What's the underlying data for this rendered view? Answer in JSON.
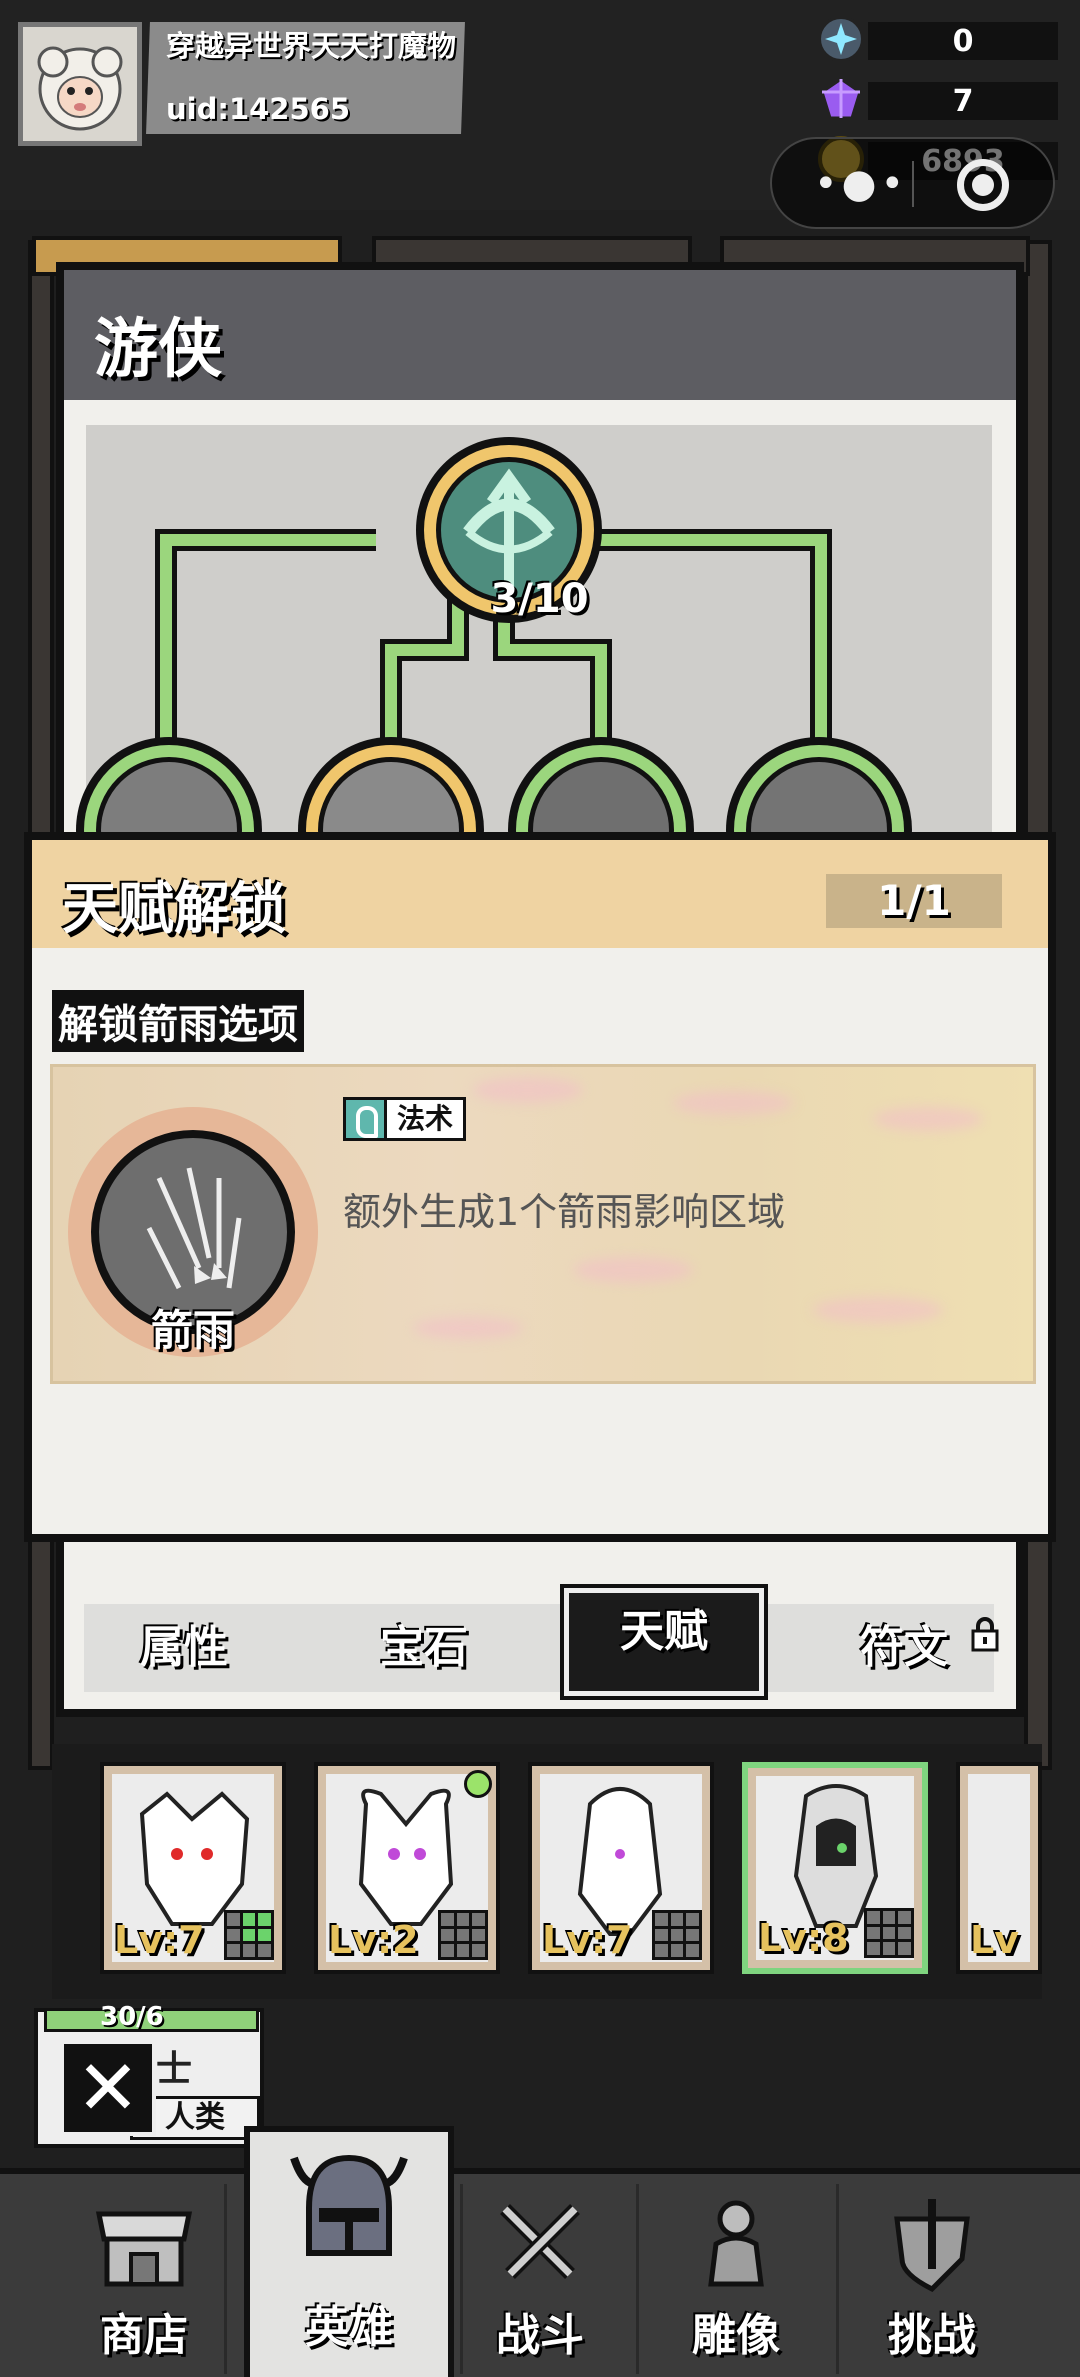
{
  "player": {
    "name": "穿越异世界天天打魔物",
    "uid": "uid:142565"
  },
  "currencies": [
    {
      "icon": "energy-crystal-icon",
      "value": "0"
    },
    {
      "icon": "purple-gem-icon",
      "value": "7"
    },
    {
      "icon": "gold-coin-icon",
      "value": "6893"
    }
  ],
  "talent": {
    "title": "游侠",
    "root_progress": "3/10"
  },
  "unlock": {
    "title": "天赋解锁",
    "count": "1/1",
    "section_label": "解锁箭雨选项",
    "option": {
      "name": "箭雨",
      "tag": "法术",
      "description": "额外生成1个箭雨影响区域"
    }
  },
  "tabs": [
    {
      "label": "属性",
      "active": false
    },
    {
      "label": "宝石",
      "active": false
    },
    {
      "label": "天赋",
      "active": true
    },
    {
      "label": "符文",
      "active": false,
      "locked": true
    }
  ],
  "heroes": [
    {
      "level": "Lv:7",
      "selected": false
    },
    {
      "level": "Lv:2",
      "selected": false,
      "badge": true
    },
    {
      "level": "Lv:7",
      "selected": false
    },
    {
      "level": "Lv:8",
      "selected": true
    },
    {
      "level": "Lv",
      "selected": false
    }
  ],
  "behind_hero": {
    "hp": "30/6",
    "class": "术士",
    "race": "人类"
  },
  "nav": [
    {
      "label": "商店",
      "icon": "shop-icon"
    },
    {
      "label": "英雄",
      "icon": "helmet-icon",
      "active": true
    },
    {
      "label": "战斗",
      "icon": "crossed-swords-icon"
    },
    {
      "label": "雕像",
      "icon": "statue-icon"
    },
    {
      "label": "挑战",
      "icon": "shield-sword-icon"
    }
  ],
  "colors": {
    "header_gray": "#5d5d62",
    "unlock_header": "#efd3a2",
    "node_green": "#9bd67d",
    "node_gold": "#f0c66c",
    "selected_hero": "#7fd47f"
  }
}
